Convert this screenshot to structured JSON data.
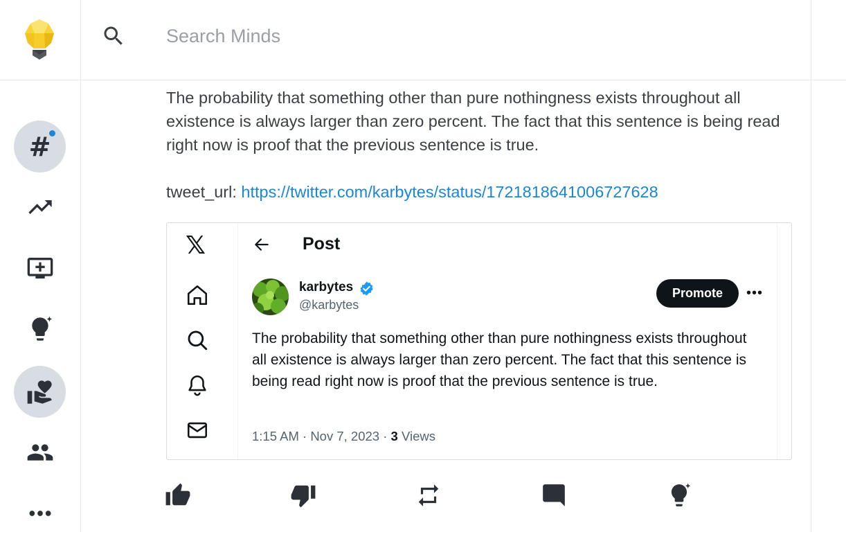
{
  "search": {
    "placeholder": "Search Minds"
  },
  "sidebar": {
    "items": [
      {
        "name": "discovery",
        "icon": "hashtag-icon",
        "glyph": "#",
        "has_notification": true,
        "active": true
      },
      {
        "name": "trending",
        "icon": "trending-up-icon",
        "active": false
      },
      {
        "name": "boost",
        "icon": "add-to-queue-icon",
        "active": false
      },
      {
        "name": "ideas",
        "icon": "lightbulb-sparkle-icon",
        "active": false
      },
      {
        "name": "supermind",
        "icon": "volunteer-activism-icon",
        "active": true
      },
      {
        "name": "groups",
        "icon": "people-icon",
        "active": false
      },
      {
        "name": "more",
        "icon": "more-horizontal-icon",
        "active": false
      }
    ]
  },
  "post": {
    "text": "The probability that something other than pure nothingness exists throughout all existence is always larger than zero percent. The fact that this sentence is being read right now is proof that the previous sentence is true.",
    "tweet_url_label": "tweet_url: ",
    "tweet_url": "https://twitter.com/karbytes/status/1721818641006727628"
  },
  "embed": {
    "brand_glyph": "𝕏",
    "header_title": "Post",
    "author_name": "karbytes",
    "author_handle": "@karbytes",
    "promote_label": "Promote",
    "more_glyph": "•••",
    "tweet_text": "The probability that something other than pure nothingness exists throughout all existence is always larger than zero percent. The fact that this sentence is being read right now is proof that the previous sentence is true.",
    "timestamp": "1:15 AM · Nov 7, 2023 · ",
    "views_count": "3",
    "views_label": " Views",
    "nav_icons": [
      "home-icon",
      "search-icon",
      "bell-icon",
      "mail-icon"
    ]
  },
  "actions": [
    {
      "name": "thumb-up-button",
      "icon": "thumb-up-icon"
    },
    {
      "name": "thumb-down-button",
      "icon": "thumb-down-icon"
    },
    {
      "name": "remind-button",
      "icon": "repeat-icon"
    },
    {
      "name": "comment-button",
      "icon": "comment-icon"
    },
    {
      "name": "supermind-button",
      "icon": "lightbulb-sparkle-icon"
    }
  ],
  "colors": {
    "accent": "#1b85d6",
    "active_bg": "#d8dde3",
    "icon": "#2c3137",
    "text": "#3a3f45",
    "logo_yellow": "#f7d33c"
  }
}
